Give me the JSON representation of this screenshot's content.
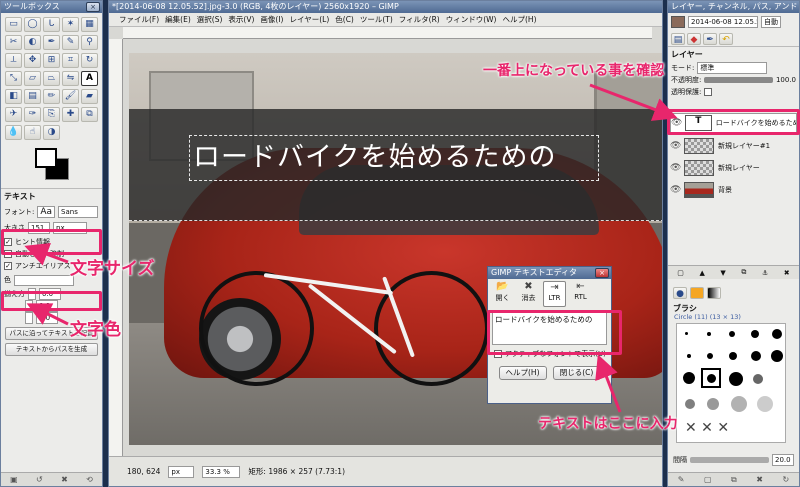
{
  "toolbox": {
    "title": "ツールボックス",
    "tool_options_title": "テキスト",
    "font_label": "フォント:",
    "font_value": "Sans",
    "font_preview": "Aa",
    "size_label": "大きさ",
    "size_value": "151",
    "size_unit": "px",
    "hinting_label": "ヒント情報",
    "force_autohint_label": "自動ヒント強制",
    "antialias_label": "アンチエイリアス",
    "color_label": "色",
    "justify_label": "揃え方",
    "spin_values": [
      "0.0",
      "0.0",
      "0.0"
    ],
    "text_along_path_button": "パスに沿ってテキストを配置",
    "path_from_text_button": "テキストからパスを生成"
  },
  "main": {
    "title": "*[2014-06-08 12.05.52].jpg-3.0 (RGB, 4枚のレイヤー) 2560x1920 – GIMP",
    "menu": [
      "ファイル(F)",
      "編集(E)",
      "選択(S)",
      "表示(V)",
      "画像(I)",
      "レイヤー(L)",
      "色(C)",
      "ツール(T)",
      "フィルタ(R)",
      "ウィンドウ(W)",
      "ヘルプ(H)"
    ],
    "canvas_text": "ロードバイクを始めるための",
    "status": {
      "coords": "180, 624",
      "unit": "px",
      "zoom": "33.3 %",
      "info": "矩形: 1986 × 257 (7.73:1)"
    }
  },
  "editor": {
    "title": "GIMP テキストエディタ",
    "open_label": "開く",
    "clear_label": "消去",
    "ltr_label": "LTR",
    "rtl_label": "RTL",
    "text_value": "ロードバイクを始めるための",
    "active_font_label": "アクティブなフォントで表示(U)",
    "help_button": "ヘルプ(H)",
    "close_button": "閉じる(C)"
  },
  "dock": {
    "title": "レイヤー, チャンネル, パス, アンドゥ…",
    "image_select": "2014-06-08 12.05.52.jpg-3",
    "auto_button": "自動",
    "layers_title": "レイヤー",
    "mode_label": "モード:",
    "mode_value": "標準",
    "opacity_label": "不透明度:",
    "opacity_value": "100.0",
    "lock_label": "透明保護:",
    "layers": [
      "ロードバイクを始めるための",
      "新規レイヤー#1",
      "新規レイヤー",
      "背景"
    ],
    "brushes_title": "ブラシ",
    "brush_name": "Circle (11) (13 × 13)",
    "spacing_label": "間隔",
    "spacing_value": "20.0"
  },
  "annotations": {
    "top_layer": "一番上になっている事を確認",
    "font_size": "文字サイズ",
    "font_color": "文字色",
    "input_here": "テキストはここに入力"
  },
  "colors": {
    "accent": "#e8266c",
    "title_bar": "#5f7aa3",
    "car": "#b22a1f",
    "band": "#2e2e2e"
  }
}
